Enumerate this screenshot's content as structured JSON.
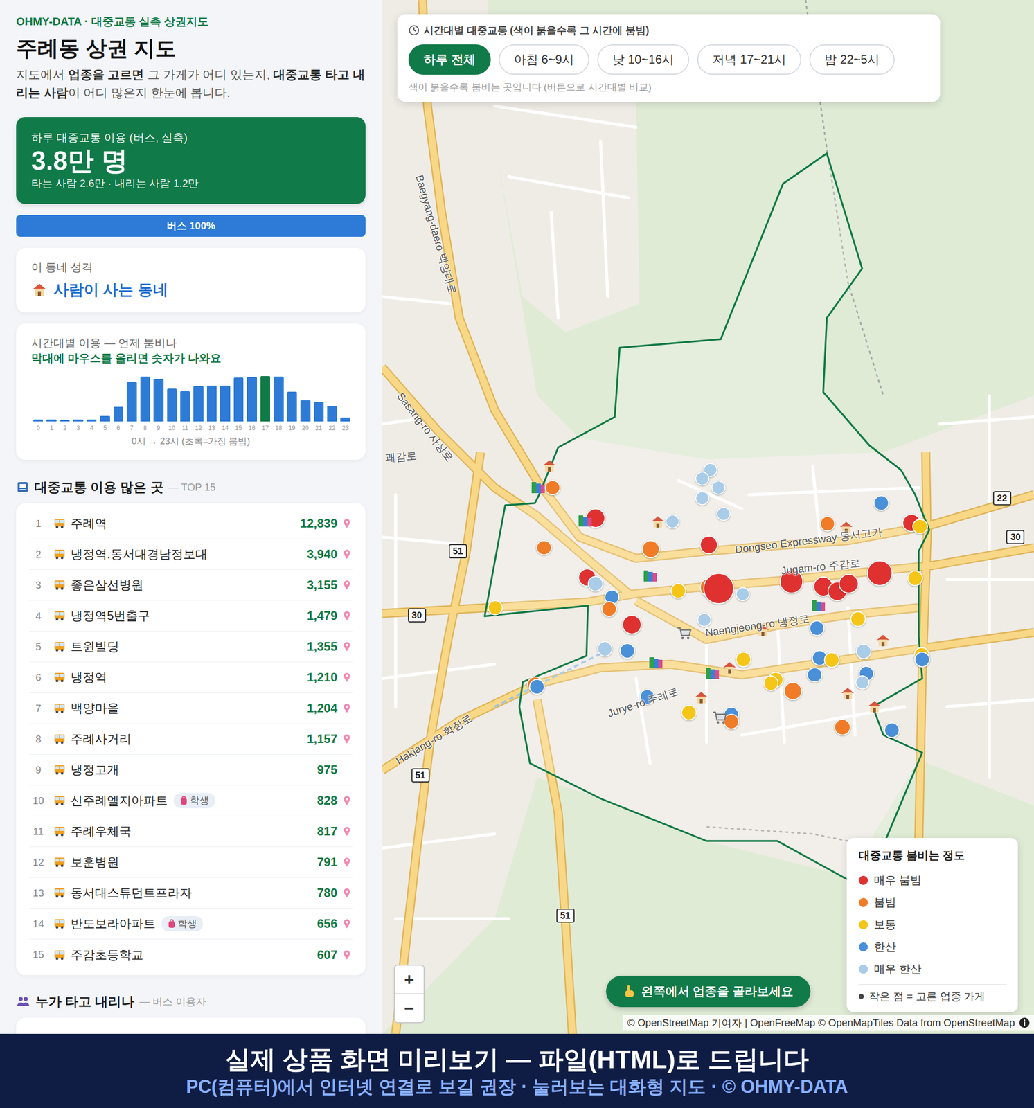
{
  "brand": "OHMY-DATA · 대중교통 실측 상권지도",
  "title": "주례동 상권 지도",
  "intro": [
    {
      "text": "지도에서 ",
      "bold": false
    },
    {
      "text": "업종을 고르면",
      "bold": true
    },
    {
      "text": " 그 가게가 어디 있는지, ",
      "bold": false
    },
    {
      "text": "대중교통 타고 내리는 사람",
      "bold": true
    },
    {
      "text": "이 어디 많은지 한눈에 봅니다.",
      "bold": false
    }
  ],
  "summary": {
    "label": "하루 대중교통 이용 (버스, 실측)",
    "value": "3.8만 명",
    "detail": "타는 사람 2.6만 · 내리는 사람 1.2만"
  },
  "mode_bar": {
    "label": "버스 100%",
    "level": 1
  },
  "character": {
    "label": "이 동네 성격",
    "value": "사람이 사는 동네"
  },
  "hourly": {
    "title": "시간대별 이용 — 언제 붐비나",
    "hint": "막대에 마우스를 올리면 숫자가 나와요",
    "hours": [
      "0",
      "1",
      "2",
      "3",
      "4",
      "5",
      "6",
      "7",
      "8",
      "9",
      "10",
      "11",
      "12",
      "13",
      "14",
      "15",
      "16",
      "17",
      "18",
      "19",
      "20",
      "21",
      "22",
      "23"
    ],
    "values": [
      130,
      120,
      110,
      120,
      140,
      360,
      950,
      2520,
      2870,
      2700,
      2110,
      1930,
      2250,
      2290,
      2300,
      2790,
      2830,
      2900,
      2880,
      1890,
      1350,
      1260,
      990,
      270
    ],
    "caption": "0시 → 23시 (초록=가장 붐빔)"
  },
  "top_stops": {
    "title": "대중교통 이용 많은 곳",
    "subtitle": "— TOP 15",
    "rows": [
      {
        "rank": "1",
        "name": "주례역",
        "count": "12,839",
        "pin": true
      },
      {
        "rank": "2",
        "name": "냉정역.동서대경남정보대",
        "count": "3,940",
        "pin": true
      },
      {
        "rank": "3",
        "name": "좋은삼선병원",
        "count": "3,155",
        "pin": true
      },
      {
        "rank": "4",
        "name": "냉정역5번출구",
        "count": "1,479",
        "pin": true
      },
      {
        "rank": "5",
        "name": "트윈빌딩",
        "count": "1,355",
        "pin": true
      },
      {
        "rank": "6",
        "name": "냉정역",
        "count": "1,210",
        "pin": true
      },
      {
        "rank": "7",
        "name": "백양마을",
        "count": "1,204",
        "pin": true
      },
      {
        "rank": "8",
        "name": "주례사거리",
        "count": "1,157",
        "pin": true
      },
      {
        "rank": "9",
        "name": "냉정고개",
        "count": "975",
        "pin": false
      },
      {
        "rank": "10",
        "name": "신주례엘지아파트",
        "badge": "학생",
        "count": "828",
        "pin": true
      },
      {
        "rank": "11",
        "name": "주례우체국",
        "count": "817",
        "pin": true
      },
      {
        "rank": "12",
        "name": "보훈병원",
        "count": "791",
        "pin": true
      },
      {
        "rank": "13",
        "name": "동서대스튜던트프라자",
        "count": "780",
        "pin": true
      },
      {
        "rank": "14",
        "name": "반도보라아파트",
        "badge": "학생",
        "count": "656",
        "pin": true
      },
      {
        "rank": "15",
        "name": "주감초등학교",
        "count": "607",
        "pin": true
      }
    ]
  },
  "riders": {
    "title": "누가 타고 내리나",
    "subtitle": "— 버스 이용자"
  },
  "time_filter": {
    "title": "시간대별 대중교통 (색이 붉을수록 그 시간에 붐빔)",
    "options": [
      {
        "label": "하루 전체",
        "selected": true
      },
      {
        "label": "아침 6~9시",
        "selected": false
      },
      {
        "label": "낮 10~16시",
        "selected": false
      },
      {
        "label": "저녁 17~21시",
        "selected": false
      },
      {
        "label": "밤 22~5시",
        "selected": false
      }
    ],
    "hint": "색이 붉을수록 붐비는 곳입니다 (버튼으로 시간대별 비교)"
  },
  "map": {
    "road_labels": [
      "Baegyang-daero 백양대로",
      "Sasang-ro 사상로",
      "괘감로",
      "Dongseo Expressway 동서고가",
      "Jugam-ro 주감로",
      "Naengjeong-ro 냉정로",
      "Jurye-ro 주례로",
      "Hakjang-ro 학장로"
    ],
    "route_shields": [
      "51",
      "30",
      "51",
      "51",
      "22",
      "30"
    ],
    "pins": [
      {
        "color": "#f07c28"
      },
      {
        "color": "#f07c28"
      },
      {
        "color": "#e03131"
      },
      {
        "color": "#e03131"
      },
      {
        "color": "#a9cce8"
      },
      {
        "color": "#4a90d9"
      },
      {
        "color": "#f07c28"
      },
      {
        "color": "#e03131"
      },
      {
        "color": "#f5c518"
      },
      {
        "color": "#a9cce8"
      },
      {
        "color": "#4a90d9"
      },
      {
        "color": "#f07c28"
      },
      {
        "color": "#4a90d9"
      },
      {
        "color": "#f07c28"
      },
      {
        "color": "#a9cce8"
      },
      {
        "color": "#e03131"
      },
      {
        "color": "#a9cce8"
      },
      {
        "color": "#a9cce8"
      },
      {
        "color": "#a9cce8"
      },
      {
        "color": "#a9cce8"
      },
      {
        "color": "#a9cce8"
      },
      {
        "color": "#f5c518"
      },
      {
        "color": "#f07c28"
      },
      {
        "color": "#e03131"
      },
      {
        "color": "#a9cce8"
      },
      {
        "color": "#e03131"
      },
      {
        "color": "#e03131"
      },
      {
        "color": "#e03131"
      },
      {
        "color": "#e03131"
      },
      {
        "color": "#e03131"
      },
      {
        "color": "#f07c28"
      },
      {
        "color": "#4a90d9"
      },
      {
        "color": "#e03131"
      },
      {
        "color": "#f5c518"
      },
      {
        "color": "#f5c518"
      },
      {
        "color": "#f5c518"
      },
      {
        "color": "#4a90d9"
      },
      {
        "color": "#a9cce8"
      },
      {
        "color": "#f5c518"
      },
      {
        "color": "#4a90d9"
      },
      {
        "color": "#f5c518"
      },
      {
        "color": "#a9cce8"
      },
      {
        "color": "#4a90d9"
      },
      {
        "color": "#a9cce8"
      },
      {
        "color": "#4a90d9"
      },
      {
        "color": "#f5c518"
      },
      {
        "color": "#f5c518"
      },
      {
        "color": "#f07c28"
      },
      {
        "color": "#4a90d9"
      },
      {
        "color": "#f5c518"
      },
      {
        "color": "#4a90d9"
      },
      {
        "color": "#f07c28"
      },
      {
        "color": "#f07c28"
      },
      {
        "color": "#4a90d9"
      },
      {
        "color": "#f5c518"
      },
      {
        "color": "#4a90d9"
      }
    ]
  },
  "legend": {
    "title": "대중교통 붐비는 정도",
    "items": [
      {
        "label": "매우 붐빔",
        "color": "#e03131"
      },
      {
        "label": "붐빔",
        "color": "#f07c28"
      },
      {
        "label": "보통",
        "color": "#f5c518"
      },
      {
        "label": "한산",
        "color": "#4a90d9"
      },
      {
        "label": "매우 한산",
        "color": "#a9cce8"
      }
    ],
    "note": "작은 점 = 고른 업종 가게"
  },
  "zoom": {
    "in": "+",
    "out": "−"
  },
  "prompt_button": "왼쪽에서 업종을 골라보세요",
  "attribution": "© OpenStreetMap 기여자 | OpenFreeMap © OpenMapTiles Data from OpenStreetMap",
  "banner": {
    "headline": "실제 상품 화면 미리보기 — 파일(HTML)로 드립니다",
    "subline": "PC(컴퓨터)에서 인터넷 연결로 보길 권장 · 눌러보는 대화형 지도 · © OHMY-DATA"
  }
}
